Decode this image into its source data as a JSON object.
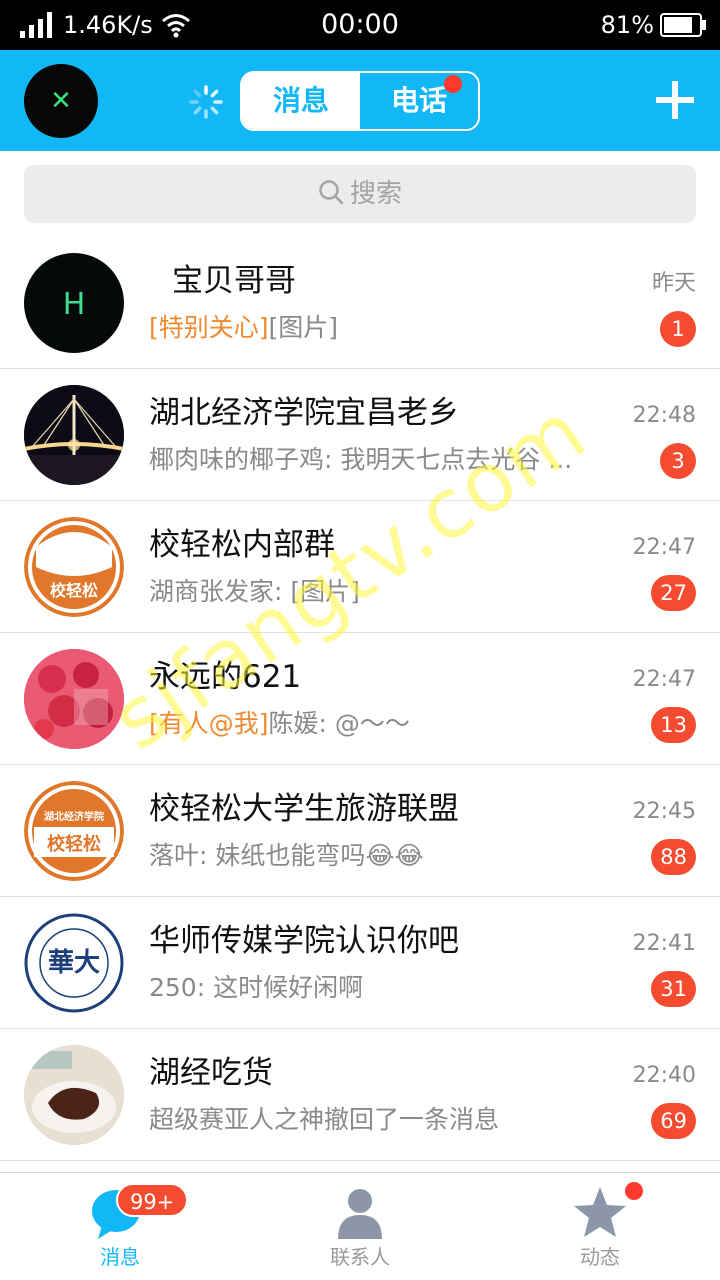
{
  "status_bar": {
    "speed": "1.46K/s",
    "time": "00:00",
    "battery": "81%"
  },
  "header": {
    "my_avatar_text": "✕",
    "tabs": [
      {
        "label": "消息",
        "active": true
      },
      {
        "label": "电话",
        "active": false
      }
    ]
  },
  "search": {
    "placeholder": "搜索"
  },
  "conversations": [
    {
      "name": "宝贝哥哥",
      "tag": "[特别关心]",
      "message": "[图片]",
      "time": "昨天",
      "badge": "1",
      "avatar": "H"
    },
    {
      "name": "湖北经济学院宜昌老乡",
      "tag": "",
      "message": "椰肉味的椰子鸡: 我明天七点去光谷 ...",
      "time": "22:48",
      "badge": "3",
      "avatar": ""
    },
    {
      "name": "校轻松内部群",
      "tag": "",
      "message": "湖商张发家: [图片]",
      "time": "22:47",
      "badge": "27",
      "avatar": "校轻松"
    },
    {
      "name": "永远的621",
      "tag": "[有人@我]",
      "message": "陈媛: @～～",
      "time": "22:47",
      "badge": "13",
      "avatar": ""
    },
    {
      "name": "校轻松大学生旅游联盟",
      "tag": "",
      "message": "落叶: 妹纸也能弯吗😂😂",
      "time": "22:45",
      "badge": "88",
      "avatar": "校轻松",
      "avatar_top": "湖北经济学院"
    },
    {
      "name": "华师传媒学院认识你吧",
      "tag": "",
      "message": "250: 这时候好闲啊",
      "time": "22:41",
      "badge": "31",
      "avatar": "華大"
    },
    {
      "name": "湖经吃货",
      "tag": "",
      "message": "超级赛亚人之神撤回了一条消息",
      "time": "22:40",
      "badge": "69",
      "avatar": ""
    }
  ],
  "watermark": "sjfangtv.com",
  "bottom_nav": {
    "items": [
      {
        "label": "消息",
        "icon": "chat-bubble-icon",
        "badge": "99+",
        "active": true
      },
      {
        "label": "联系人",
        "icon": "person-icon",
        "active": false
      },
      {
        "label": "动态",
        "icon": "star-icon",
        "active": false
      }
    ]
  },
  "colors": {
    "brand": "#12b7f5",
    "badge": "#f54b30",
    "tag": "#ef8a2f"
  }
}
